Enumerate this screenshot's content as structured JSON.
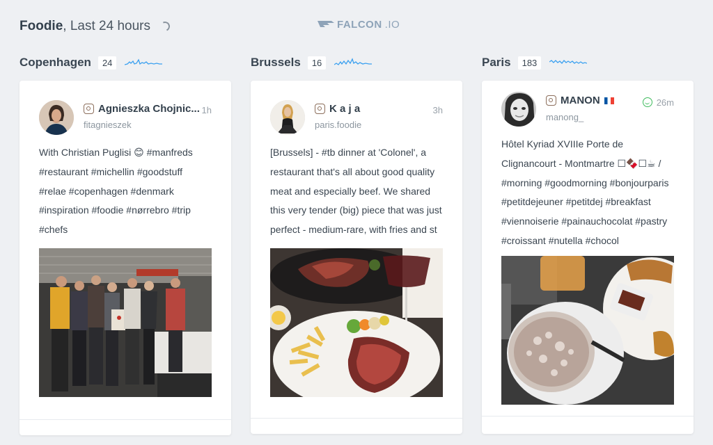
{
  "header": {
    "title_bold": "Foodie",
    "title_rest": ", Last 24 hours"
  },
  "logo": {
    "bold": "FALCON",
    "light": ".IO"
  },
  "columns": [
    {
      "name": "Copenhagen",
      "count": "24",
      "post": {
        "user": "Agnieszka Chojnic...",
        "handle": "fitagnieszek",
        "time": "1h",
        "text": "With Christian Puglisi 😊 #manfreds #restaurant #michellin #goodstuff #relae #copenhagen #denmark #inspiration #foodie #nørrebro #trip #chefs"
      }
    },
    {
      "name": "Brussels",
      "count": "16",
      "post": {
        "user": "K a j a",
        "handle": "paris.foodie",
        "time": "3h",
        "text": "[Brussels] - #tb dinner at 'Colonel', a restaurant that's all about good quality meat and especially beef. We shared this very tender (big) piece that was just perfect - medium-rare, with fries and st"
      }
    },
    {
      "name": "Paris",
      "count": "183",
      "post": {
        "user": "MANON",
        "handle": "manong_",
        "time": "26m",
        "text": "Hôtel Kyriad XVIIIe Porte de Clignancourt - Montmartre ☐🍫☐☕ / #morning #goodmorning #bonjourparis #petitdejeuner #petitdej #breakfast #viennoiserie #painauchocolat #pastry #croissant #nutella #chocol"
      }
    }
  ],
  "colors": {
    "spark": "#3aa0f0",
    "sentiment": "#3dbb5c"
  },
  "icons": [
    "instagram-icon",
    "smile-icon",
    "france-flag-icon",
    "loading-spinner-icon"
  ]
}
